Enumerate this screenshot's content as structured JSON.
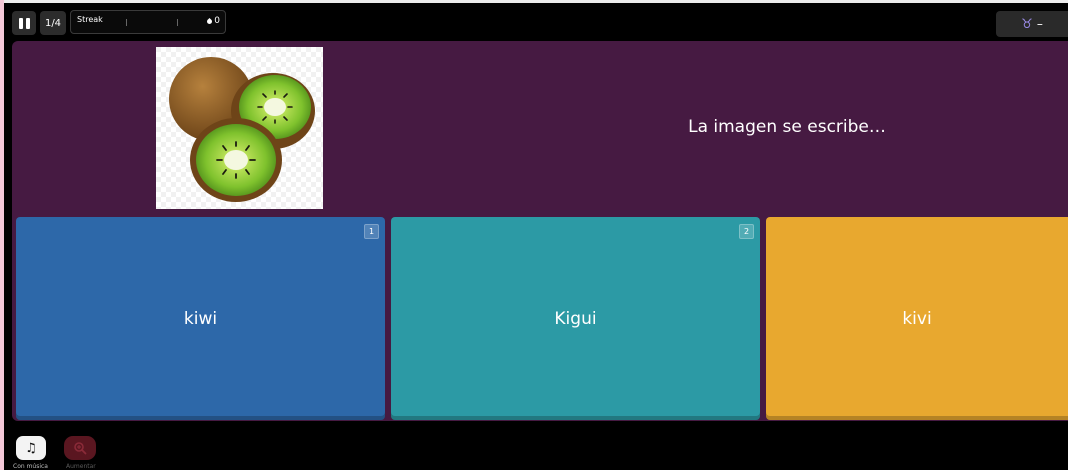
{
  "topbar": {
    "question_counter": "1/4",
    "streak_label": "Streak",
    "streak_count": "0",
    "power_value": "–",
    "icons": {
      "pause": "pause-icon",
      "streak_drop": "drop-icon",
      "power": "taurus-icon"
    }
  },
  "question": {
    "text": "La imagen se escribe…",
    "image": "kiwi-fruit-image"
  },
  "answers": [
    {
      "number": "1",
      "label": "kiwi",
      "color": "#2d68a9"
    },
    {
      "number": "2",
      "label": "Kigui",
      "color": "#2c9aa5"
    },
    {
      "number": "",
      "label": "kivi",
      "color": "#e8a82f"
    }
  ],
  "bottombar": {
    "music_label": "Con música",
    "zoom_label": "Aumentar",
    "icons": {
      "music": "music-note-icon",
      "zoom": "zoom-in-icon"
    }
  },
  "colors": {
    "stage_background": "#461a42",
    "power_icon": "#9a8ae6"
  }
}
